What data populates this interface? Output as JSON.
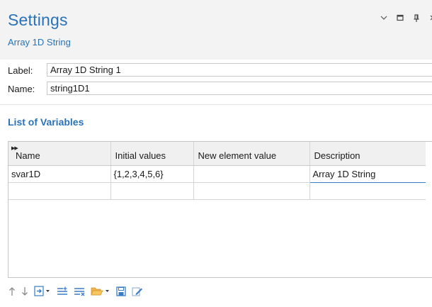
{
  "header": {
    "title": "Settings",
    "subtitle": "Array 1D String",
    "window_controls": [
      "chevron-down-icon",
      "maximize-icon",
      "pin-icon",
      "close-icon"
    ]
  },
  "fields": {
    "label": {
      "caption": "Label:",
      "value": "Array 1D String 1"
    },
    "name": {
      "caption": "Name:",
      "value": "string1D1"
    }
  },
  "section": {
    "title": "List of Variables"
  },
  "table": {
    "columns": [
      "Name",
      "Initial values",
      "New element value",
      "Description"
    ],
    "rows": [
      [
        "svar1D",
        "{1,2,3,4,5,6}",
        "",
        "Array 1D String"
      ],
      [
        "",
        "",
        "",
        ""
      ]
    ]
  },
  "toolbar": {
    "icons": [
      "move-up-icon",
      "move-down-icon",
      "add-element-icon",
      "insert-row-icon",
      "clear-table-icon",
      "open-folder-icon",
      "save-icon",
      "edit-icon"
    ]
  },
  "colors": {
    "accent": "#2a73b8",
    "header_bg": "#f3f3f3",
    "selection_border": "#3c7fc1"
  }
}
